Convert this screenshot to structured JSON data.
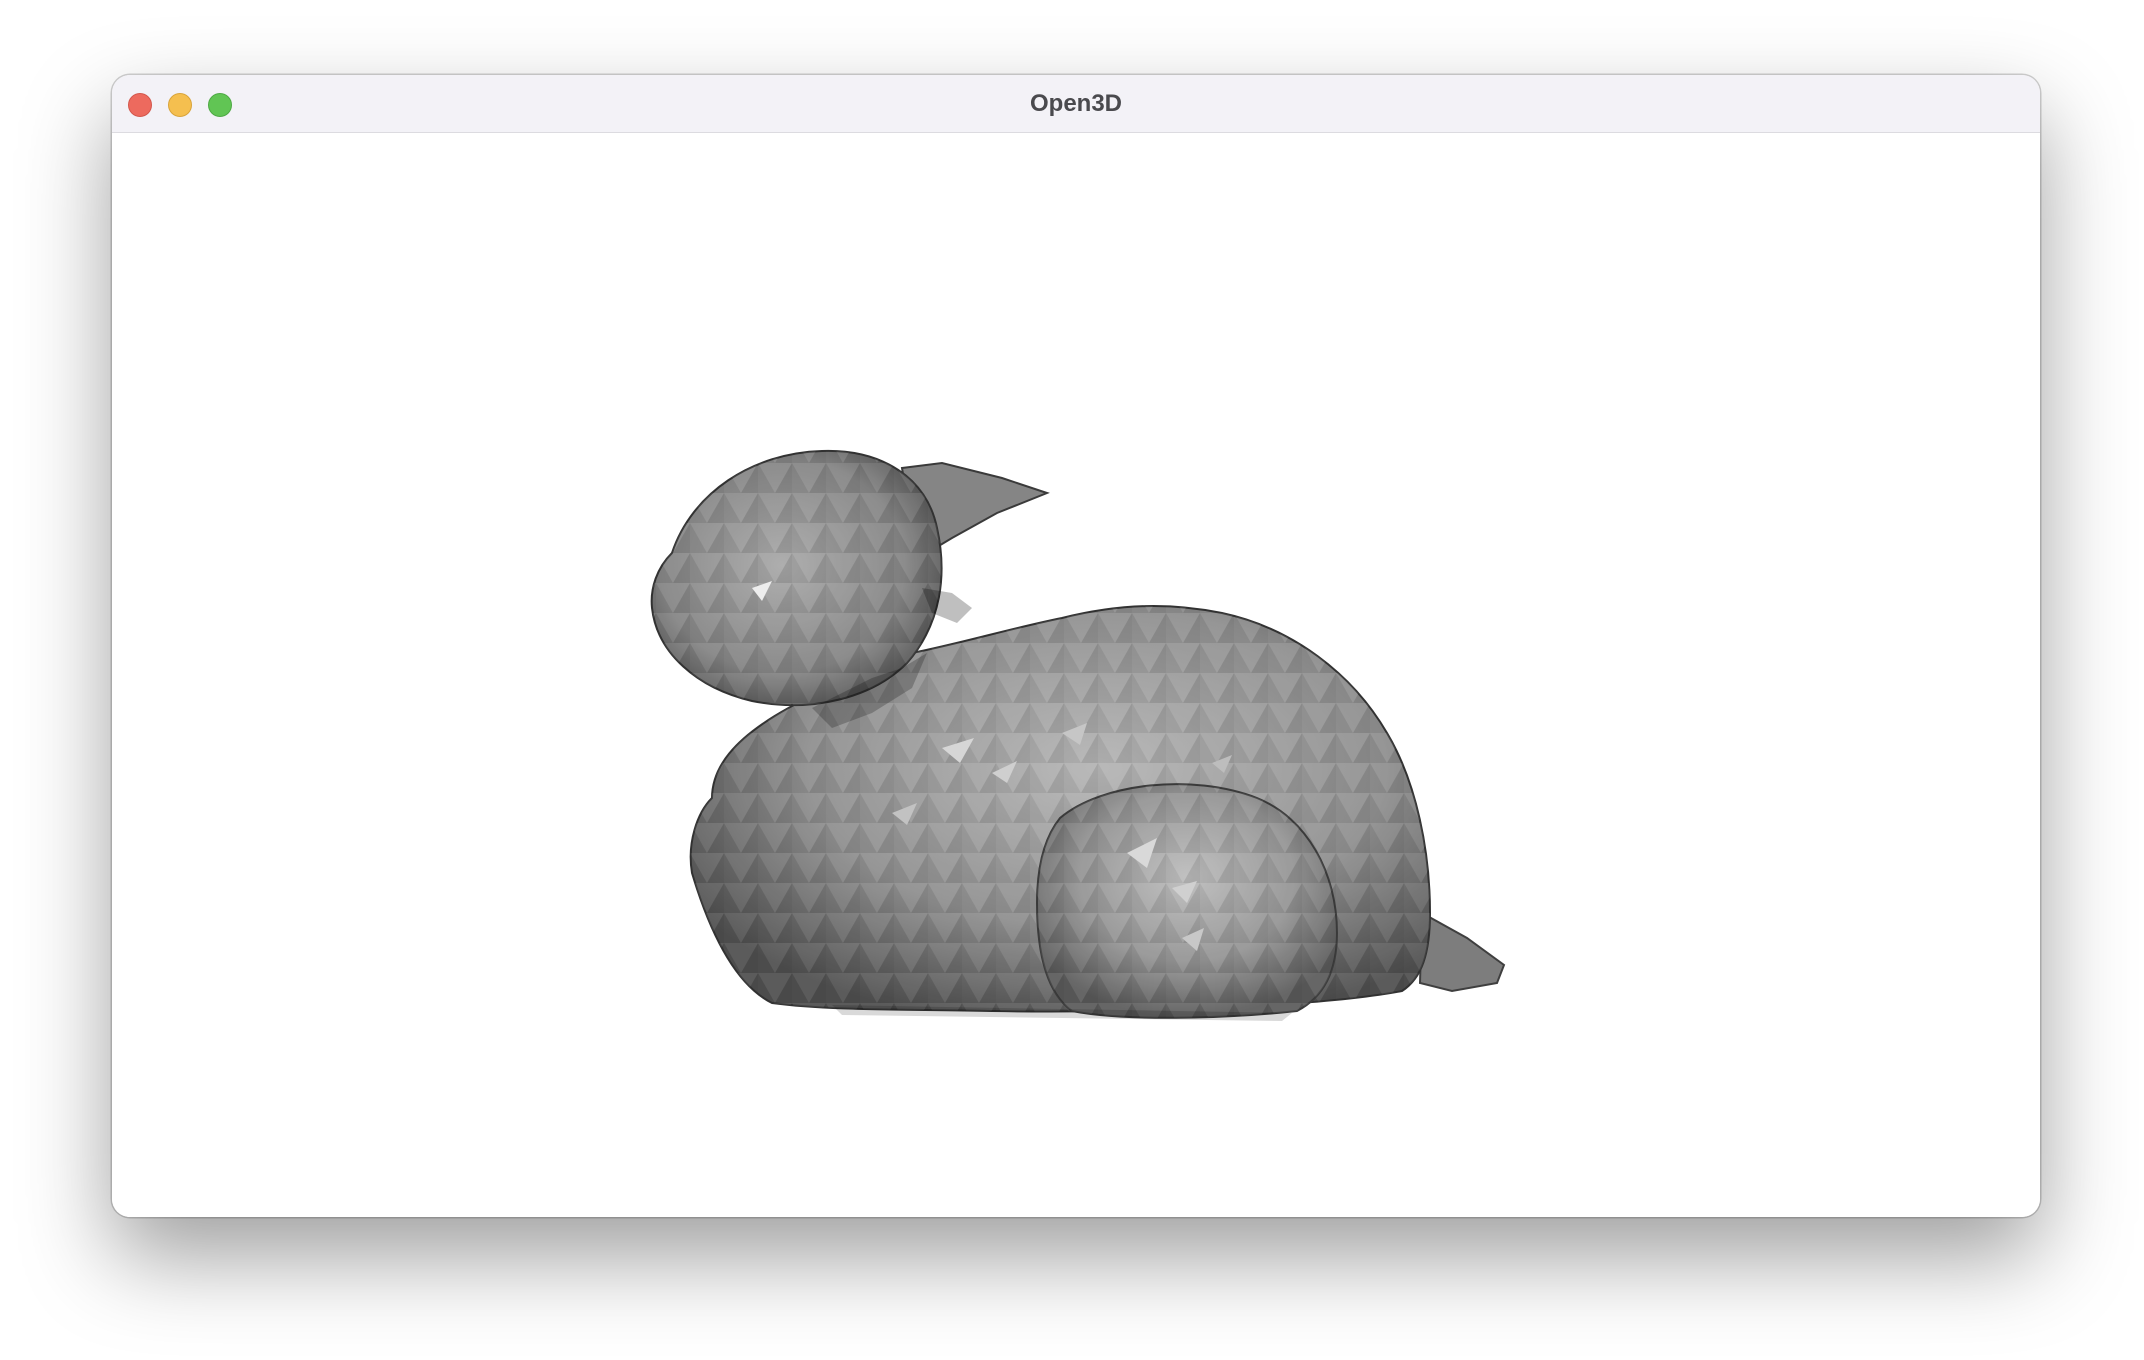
{
  "window": {
    "title": "Open3D"
  },
  "controls": {
    "close_color": "#ed6a5e",
    "minimize_color": "#f5bf4f",
    "zoom_color": "#61c554"
  },
  "scene": {
    "background": "#ffffff",
    "mesh_color": "#8c8c8c",
    "object": "bunny-mesh"
  }
}
